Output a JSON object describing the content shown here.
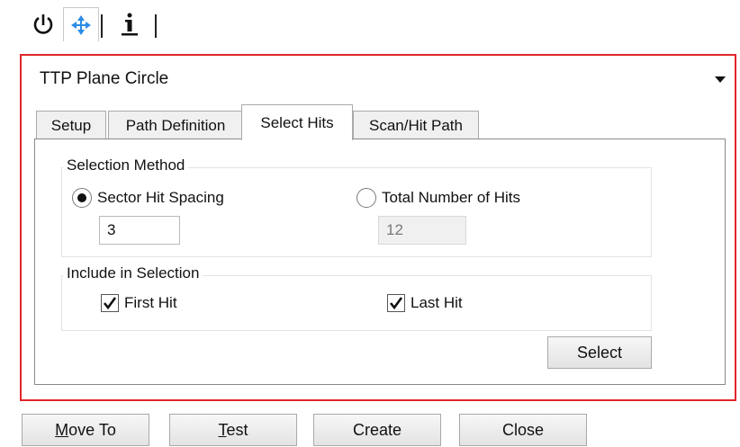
{
  "toolbar": {
    "icons": [
      "power-icon",
      "move-arrows-icon",
      "info-icon"
    ]
  },
  "feature": {
    "selected": "TTP Plane Circle"
  },
  "tabs": [
    {
      "label": "Setup",
      "active": false
    },
    {
      "label": "Path Definition",
      "active": false
    },
    {
      "label": "Select Hits",
      "active": true
    },
    {
      "label": "Scan/Hit Path",
      "active": false
    }
  ],
  "selection_method": {
    "title": "Selection Method",
    "sector_label": "Sector Hit Spacing",
    "sector_selected": true,
    "sector_value": "3",
    "total_label": "Total Number of Hits",
    "total_selected": false,
    "total_value": "12"
  },
  "include": {
    "title": "Include in Selection",
    "first_label": "First Hit",
    "first_checked": true,
    "last_label": "Last Hit",
    "last_checked": true
  },
  "buttons": {
    "select": "Select"
  },
  "bottom_buttons": [
    {
      "label": "Move To",
      "mnemonic": "M"
    },
    {
      "label": "Test",
      "mnemonic": "T"
    },
    {
      "label": "Create",
      "mnemonic": ""
    },
    {
      "label": "Close",
      "mnemonic": ""
    }
  ],
  "colors": {
    "highlight_frame": "#e1262b",
    "arrow_icon": "#2b8be6"
  }
}
